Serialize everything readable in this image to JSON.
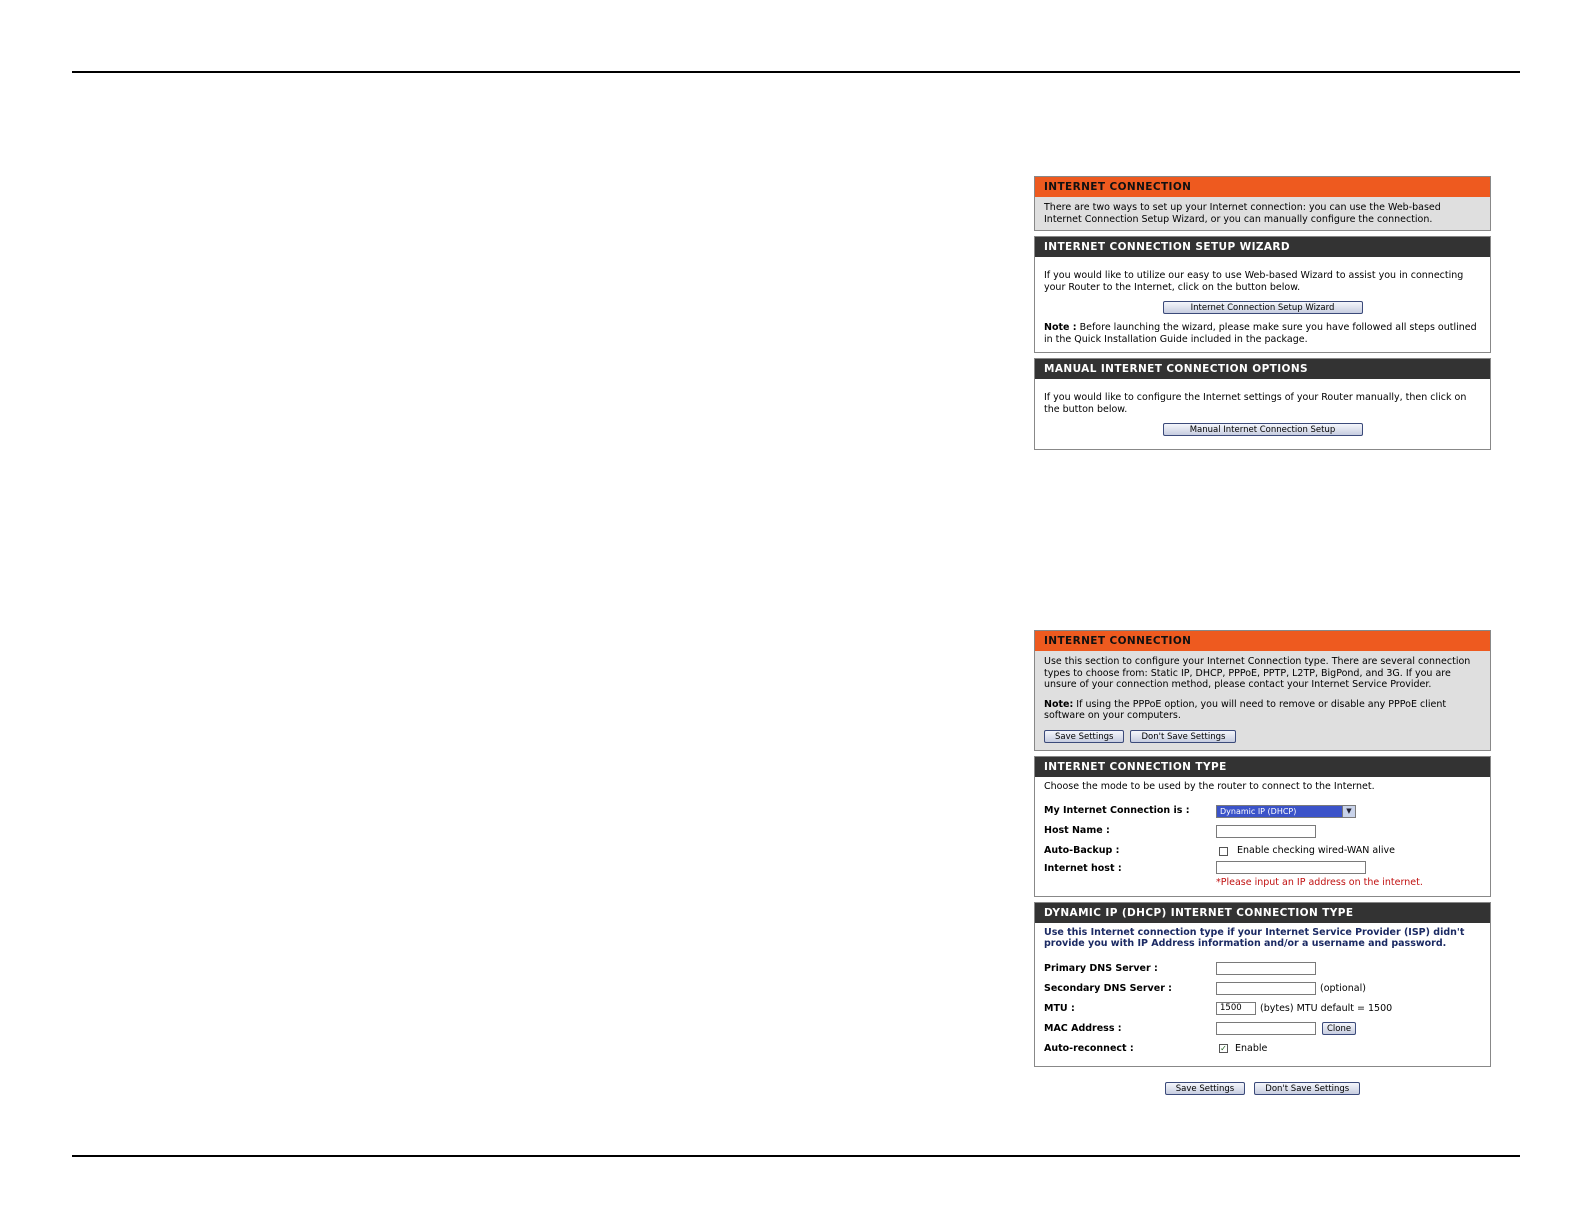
{
  "panel1": {
    "intro_title": "INTERNET CONNECTION",
    "intro_text": "There are two ways to set up your Internet connection: you can use the Web-based Internet Connection Setup Wizard, or you can manually configure the connection.",
    "wizard_title": "INTERNET CONNECTION SETUP WIZARD",
    "wizard_text": "If you would like to utilize our easy to use Web-based Wizard to assist you in connecting your Router to the Internet, click on the button below.",
    "wizard_button": "Internet Connection Setup Wizard",
    "note_label": "Note :",
    "note_text": " Before launching the wizard, please make sure you have followed all steps outlined in the Quick Installation Guide included in the package.",
    "manual_title": "MANUAL INTERNET CONNECTION OPTIONS",
    "manual_text": "If you would like to configure the Internet settings of your Router manually, then click on the button below.",
    "manual_button": "Manual Internet Connection Setup"
  },
  "panel2": {
    "intro_title": "INTERNET CONNECTION",
    "intro_text": "Use this section to configure your Internet Connection type. There are several connection types to choose from: Static IP, DHCP, PPPoE, PPTP, L2TP, BigPond, and 3G. If you are unsure of your connection method, please contact your Internet Service Provider.",
    "note_label": "Note:",
    "note_text": " If using the PPPoE option, you will need to remove or disable any PPPoE client software on your computers.",
    "save_button": "Save Settings",
    "dont_save_button": "Don't Save Settings",
    "type_title": "INTERNET CONNECTION TYPE",
    "type_text": "Choose the mode to be used by the router to connect to the Internet.",
    "my_conn_label": "My Internet Connection is :",
    "my_conn_value": "Dynamic IP (DHCP)",
    "host_name_label": "Host Name :",
    "auto_backup_label": "Auto-Backup :",
    "auto_backup_option": "Enable checking wired-WAN alive",
    "internet_host_label": "Internet host :",
    "internet_host_hint": "*Please input an IP address on the internet.",
    "dhcp_title": "DYNAMIC IP (DHCP) INTERNET CONNECTION TYPE",
    "dhcp_text": "Use this Internet connection type if your Internet Service Provider (ISP) didn't provide you with IP Address information and/or a username and password.",
    "primary_dns_label": "Primary DNS Server :",
    "secondary_dns_label": "Secondary DNS Server :",
    "optional_text": "(optional)",
    "mtu_label": "MTU :",
    "mtu_value": "1500",
    "mtu_hint": "(bytes) MTU default = 1500",
    "mac_label": "MAC Address :",
    "clone_button": "Clone",
    "auto_reconnect_label": "Auto-reconnect :",
    "auto_reconnect_option": "Enable",
    "bottom_save_button": "Save Settings",
    "bottom_dont_save_button": "Don't Save Settings"
  },
  "colors": {
    "orange_header": "#ee5a1f",
    "dark_header": "#333333",
    "link_blue": "#1b2a63",
    "error_red": "#c01010"
  }
}
